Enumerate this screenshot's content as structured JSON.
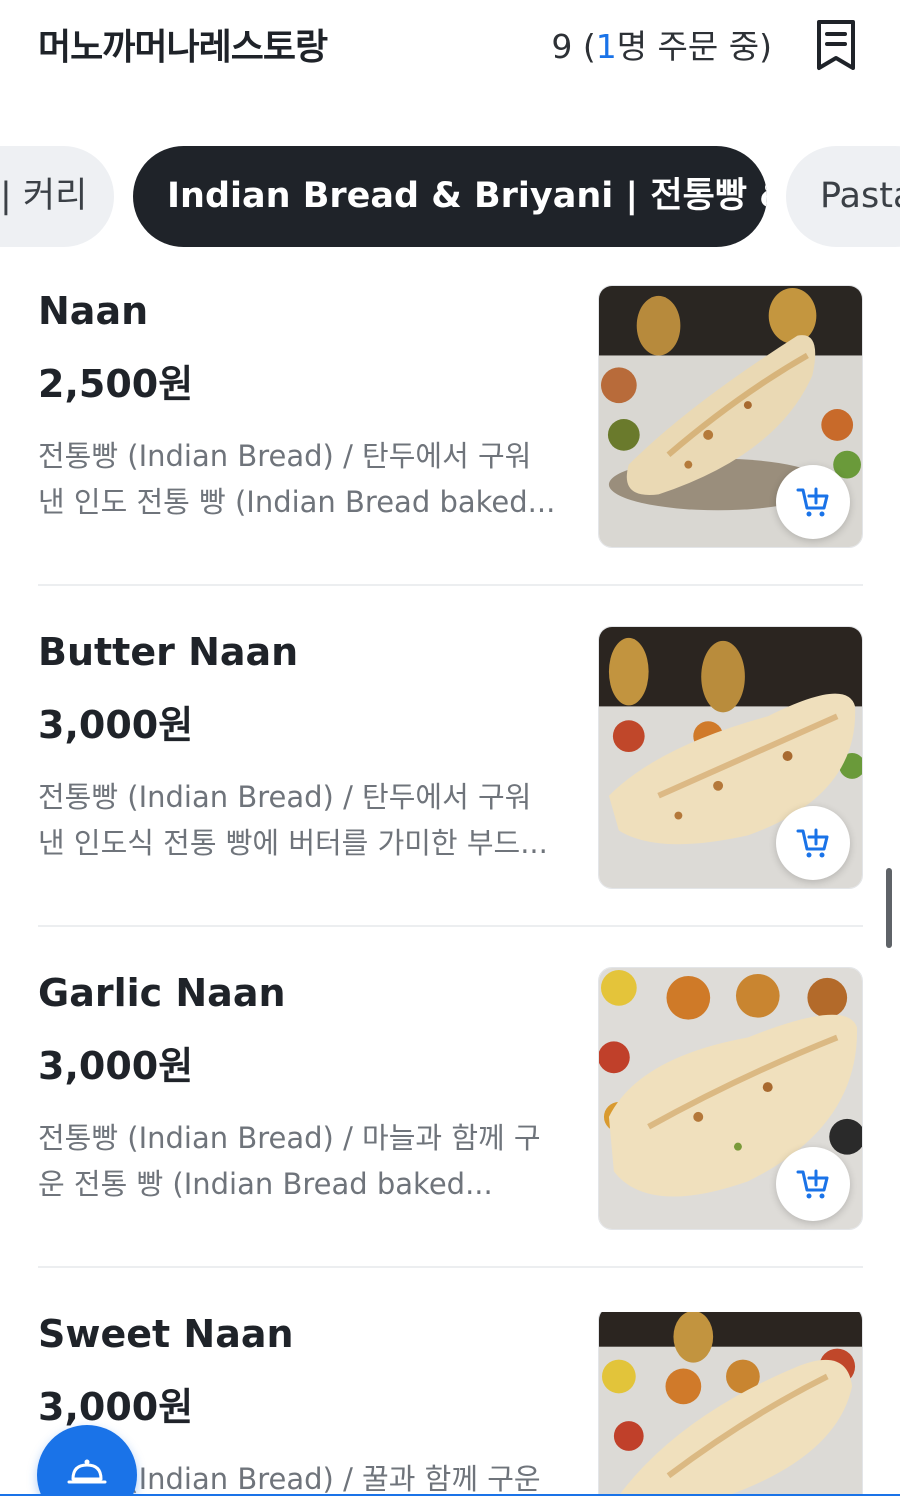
{
  "header": {
    "store_name": "머노까머나레스토랑",
    "order_count": "9",
    "order_open": " (",
    "order_highlight": "1",
    "order_rest": "명 주문 중)",
    "order_icon": "receipt-icon"
  },
  "tabs": [
    {
      "label": "| 커리",
      "active": false
    },
    {
      "label": "Indian Bread & Briyani | 전통빵 & 밥",
      "active": true
    },
    {
      "label": "Pasta",
      "active": false
    }
  ],
  "items": [
    {
      "name": "Naan",
      "price": "2,500원",
      "desc_line1": "전통빵 (Indian Bread) / 탄두에서 구워",
      "desc_line2": "낸 인도 전통 빵 (Indian Bread baked...",
      "image": "naan-photo"
    },
    {
      "name": "Butter Naan",
      "price": "3,000원",
      "desc_line1": "전통빵 (Indian Bread) / 탄두에서 구워",
      "desc_line2": "낸 인도식 전통 빵에 버터를 가미한 부드...",
      "image": "butter-naan-photo"
    },
    {
      "name": "Garlic Naan",
      "price": "3,000원",
      "desc_line1": "전통빵 (Indian Bread) / 마늘과 함께 구",
      "desc_line2": "운 전통 빵 (Indian Bread baked...",
      "image": "garlic-naan-photo"
    },
    {
      "name": "Sweet Naan",
      "price": "3,000원",
      "desc_line1": "전통빵 (Indian Bread) / 꿀과 함께 구운",
      "desc_line2": "",
      "image": "sweet-naan-photo"
    }
  ],
  "colors": {
    "accent": "#1a73e8",
    "active_tab": "#1f2329",
    "tab_bg": "#eef0f3",
    "desc_text": "#6f747b"
  },
  "icons": {
    "cart": "add-to-cart-icon",
    "fab": "service-bell-icon"
  }
}
